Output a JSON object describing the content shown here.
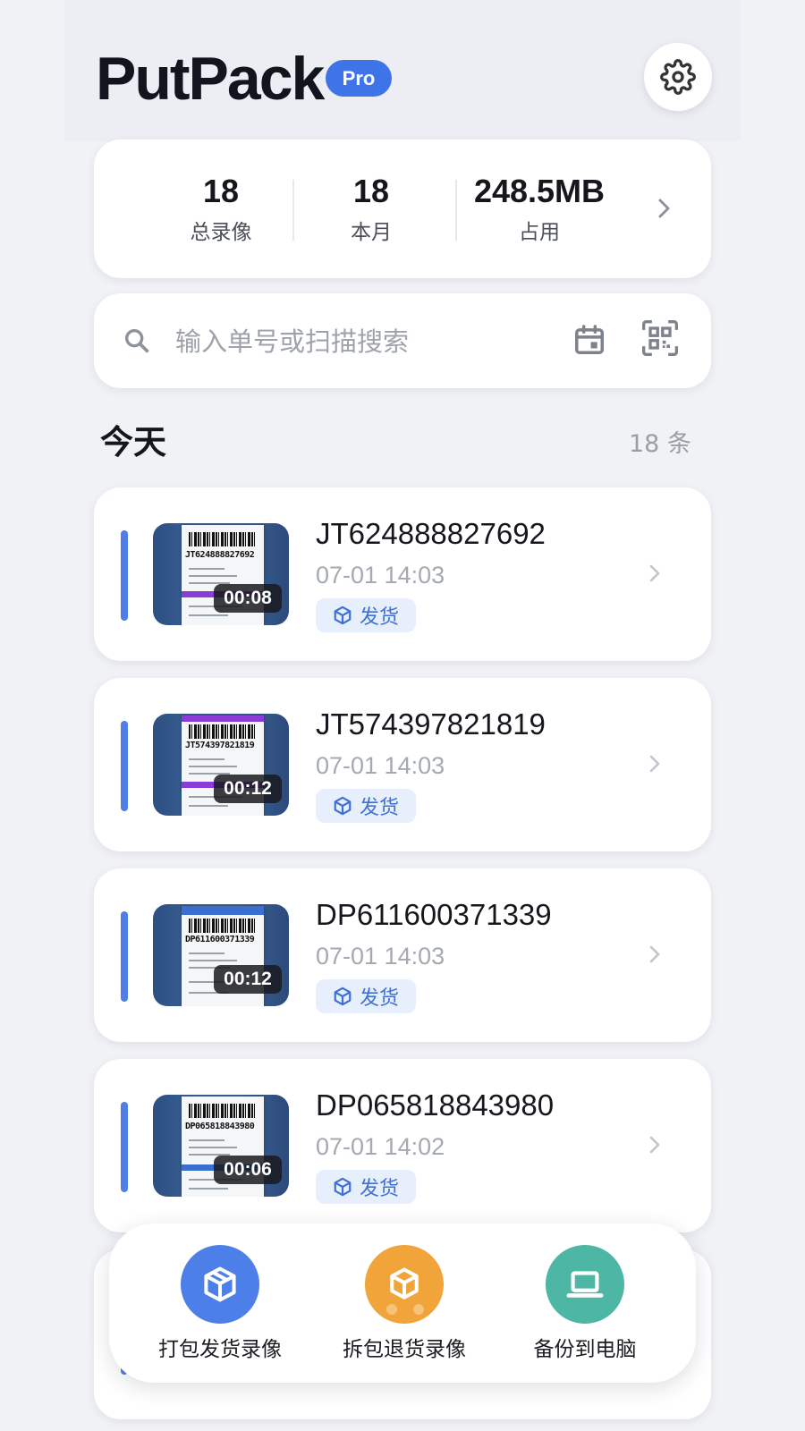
{
  "header": {
    "app_name": "PutPack",
    "badge": "Pro",
    "settings_icon": "gear-icon"
  },
  "stats": [
    {
      "value": "18",
      "label": "总录像"
    },
    {
      "value": "18",
      "label": "本月"
    },
    {
      "value": "248.5MB",
      "label": "占用"
    }
  ],
  "search": {
    "placeholder": "输入单号或扫描搜索",
    "value": ""
  },
  "section": {
    "title": "今天",
    "count": "18 条"
  },
  "records": [
    {
      "order_no": "JT624888827692",
      "time": "07-01 14:03",
      "duration": "00:08",
      "tag": "发货",
      "label_code": "JT624888827692"
    },
    {
      "order_no": "JT574397821819",
      "time": "07-01 14:03",
      "duration": "00:12",
      "tag": "发货",
      "label_code": "JT574397821819"
    },
    {
      "order_no": "DP611600371339",
      "time": "07-01 14:03",
      "duration": "00:12",
      "tag": "发货",
      "label_code": "DP611600371339"
    },
    {
      "order_no": "DP065818843980",
      "time": "07-01 14:02",
      "duration": "00:06",
      "tag": "发货",
      "label_code": "DP065818843980"
    }
  ],
  "actions": [
    {
      "label": "打包发货录像",
      "color": "#4c80e8",
      "icon": "package-icon"
    },
    {
      "label": "拆包退货录像",
      "color": "#f0a43a",
      "icon": "open-package-icon"
    },
    {
      "label": "备份到电脑",
      "color": "#4db6a4",
      "icon": "laptop-icon"
    }
  ],
  "colors": {
    "accent": "#3e74e8",
    "background": "#f1f2f6",
    "tag_bg": "#e7effc"
  }
}
